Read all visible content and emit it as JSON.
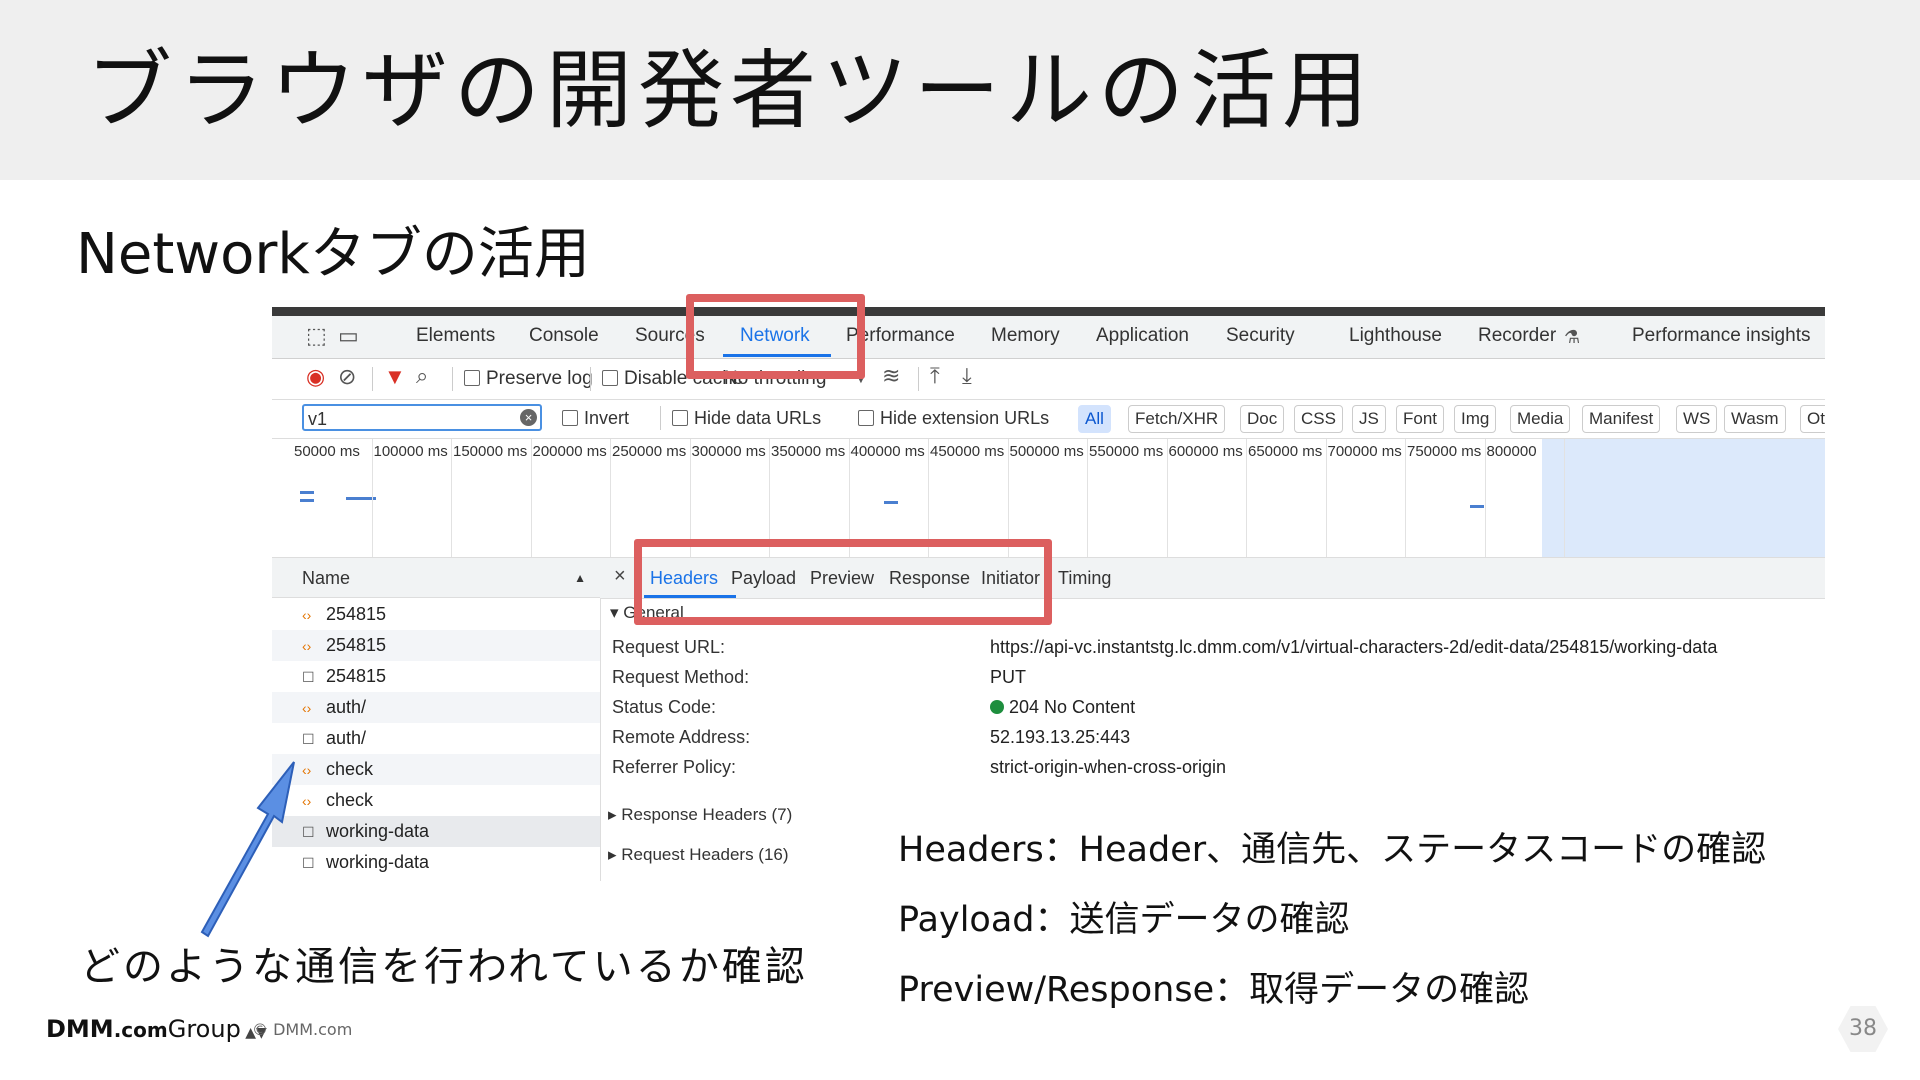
{
  "title": "ブラウザの開発者ツールの活用",
  "subtitle": "Networkタブの活用",
  "devtools": {
    "tabs": [
      "Elements",
      "Console",
      "Sources",
      "Network",
      "Performance",
      "Memory",
      "Application",
      "Security",
      "Lighthouse",
      "Recorder",
      "Performance insights"
    ],
    "active_tab": "Network",
    "toolbar": {
      "preserve_log": "Preserve log",
      "disable_cache": "Disable cache",
      "throttling": "No throttling"
    },
    "filter": {
      "value": "v1",
      "invert": "Invert",
      "hide_data_urls": "Hide data URLs",
      "hide_extension_urls": "Hide extension URLs",
      "types": [
        "All",
        "Fetch/XHR",
        "Doc",
        "CSS",
        "JS",
        "Font",
        "Img",
        "Media",
        "Manifest",
        "WS",
        "Wasm",
        "Ot"
      ]
    },
    "timeline_ticks": [
      "50000 ms",
      "100000 ms",
      "150000 ms",
      "200000 ms",
      "250000 ms",
      "300000 ms",
      "350000 ms",
      "400000 ms",
      "450000 ms",
      "500000 ms",
      "550000 ms",
      "600000 ms",
      "650000 ms",
      "700000 ms",
      "750000 ms",
      "800000"
    ],
    "name_header": "Name",
    "requests": [
      {
        "name": "254815",
        "type": "fetch"
      },
      {
        "name": "254815",
        "type": "fetch"
      },
      {
        "name": "254815",
        "type": "doc"
      },
      {
        "name": "auth/",
        "type": "fetch"
      },
      {
        "name": "auth/",
        "type": "doc"
      },
      {
        "name": "check",
        "type": "fetch"
      },
      {
        "name": "check",
        "type": "fetch"
      },
      {
        "name": "working-data",
        "type": "doc"
      },
      {
        "name": "working-data",
        "type": "doc"
      }
    ],
    "detail_tabs": [
      "Headers",
      "Payload",
      "Preview",
      "Response",
      "Initiator",
      "Timing"
    ],
    "general": {
      "section": "General",
      "rows": [
        {
          "k": "Request URL:",
          "v": "https://api-vc.instantstg.lc.dmm.com/v1/virtual-characters-2d/edit-data/254815/working-data"
        },
        {
          "k": "Request Method:",
          "v": "PUT"
        },
        {
          "k": "Status Code:",
          "v": "204 No Content"
        },
        {
          "k": "Remote Address:",
          "v": "52.193.13.25:443"
        },
        {
          "k": "Referrer Policy:",
          "v": "strict-origin-when-cross-origin"
        }
      ],
      "response_headers": "Response Headers (7)",
      "request_headers": "Request Headers (16)"
    }
  },
  "notes": [
    "Headers：Header、通信先、ステータスコードの確認",
    "Payload：送信データの確認",
    "Preview/Response：取得データの確認"
  ],
  "caption": "どのような通信を行われているか確認",
  "footer": {
    "logo_main": "DMM",
    "logo_com": ".com",
    "logo_group": "Group",
    "copyright": "© DMM.com",
    "page": "38"
  },
  "colors": {
    "highlight": "#dc5f5f",
    "arrow": "#5b8fe3",
    "active_blue": "#1a73e8"
  }
}
